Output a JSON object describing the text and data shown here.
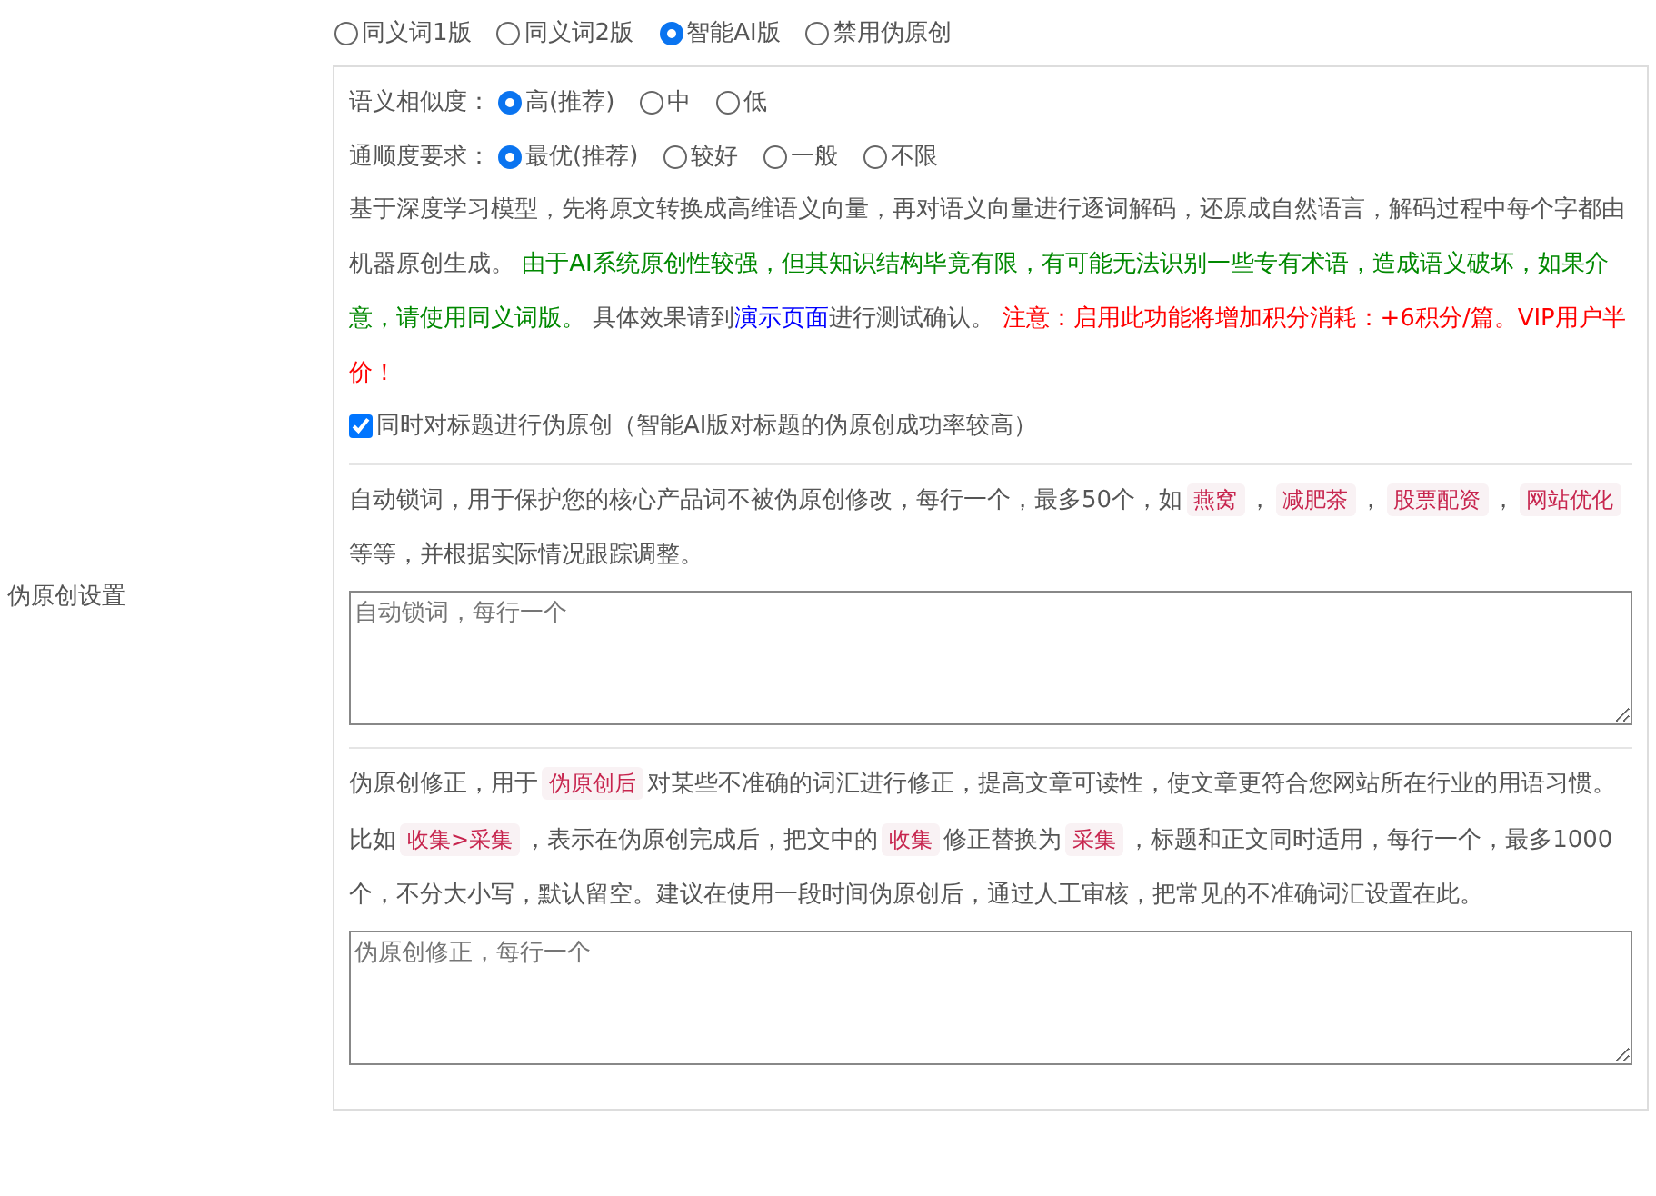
{
  "label": "伪原创设置",
  "modes": [
    {
      "label": "同义词1版",
      "selected": false
    },
    {
      "label": "同义词2版",
      "selected": false
    },
    {
      "label": "智能AI版",
      "selected": true
    },
    {
      "label": "禁用伪原创",
      "selected": false
    }
  ],
  "similarity": {
    "label": "语义相似度：",
    "options": [
      {
        "label": "高(推荐)",
        "selected": true
      },
      {
        "label": "中",
        "selected": false
      },
      {
        "label": "低",
        "selected": false
      }
    ]
  },
  "fluency": {
    "label": "通顺度要求：",
    "options": [
      {
        "label": "最优(推荐)",
        "selected": true
      },
      {
        "label": "较好",
        "selected": false
      },
      {
        "label": "一般",
        "selected": false
      },
      {
        "label": "不限",
        "selected": false
      }
    ]
  },
  "ai_note": [
    {
      "kind": "text",
      "text": "基于深度学习模型，先将原文转换成高维语义向量，再对语义向量进行逐词解码，还原成自然语言，解码过程中每个字都由机器原创生成。 "
    },
    {
      "kind": "green",
      "text": "由于AI系统原创性较强，但其知识结构毕竟有限，有可能无法识别一些专有术语，造成语义破坏，如果介意，请使用同义词版。"
    },
    {
      "kind": "text",
      "text": " 具体效果请到"
    },
    {
      "kind": "link",
      "text": "演示页面"
    },
    {
      "kind": "text",
      "text": "进行测试确认。 "
    },
    {
      "kind": "red",
      "text": "注意：启用此功能将增加积分消耗：+6积分/篇。VIP用户半价！"
    }
  ],
  "title_option": {
    "label": "同时对标题进行伪原创（智能AI版对标题的伪原创成功率较高）",
    "checked": true
  },
  "lock_words": {
    "description": [
      {
        "kind": "text",
        "text": "自动锁词，用于保护您的核心产品词不被伪原创修改，每行一个，最多50个，如"
      },
      {
        "kind": "code",
        "text": "燕窝"
      },
      {
        "kind": "text",
        "text": "，"
      },
      {
        "kind": "code",
        "text": "减肥茶"
      },
      {
        "kind": "text",
        "text": "，"
      },
      {
        "kind": "code",
        "text": "股票配资"
      },
      {
        "kind": "text",
        "text": "，"
      },
      {
        "kind": "code",
        "text": "网站优化"
      },
      {
        "kind": "text",
        "text": "等等，并根据实际情况跟踪调整。"
      }
    ],
    "placeholder": "自动锁词，每行一个"
  },
  "correction": {
    "description": [
      {
        "kind": "text",
        "text": "伪原创修正，用于"
      },
      {
        "kind": "code",
        "text": "伪原创后"
      },
      {
        "kind": "text",
        "text": "对某些不准确的词汇进行修正，提高文章可读性，使文章更符合您网站所在行业的用语习惯。比如"
      },
      {
        "kind": "code",
        "text": "收集>采集"
      },
      {
        "kind": "text",
        "text": "，表示在伪原创完成后，把文中的"
      },
      {
        "kind": "code",
        "text": "收集"
      },
      {
        "kind": "text",
        "text": "修正替换为"
      },
      {
        "kind": "code",
        "text": "采集"
      },
      {
        "kind": "text",
        "text": "，标题和正文同时适用，每行一个，最多1000个，不分大小写，默认留空。建议在使用一段时间伪原创后，通过人工审核，把常见的不准确词汇设置在此。"
      }
    ],
    "placeholder": "伪原创修正，每行一个"
  }
}
